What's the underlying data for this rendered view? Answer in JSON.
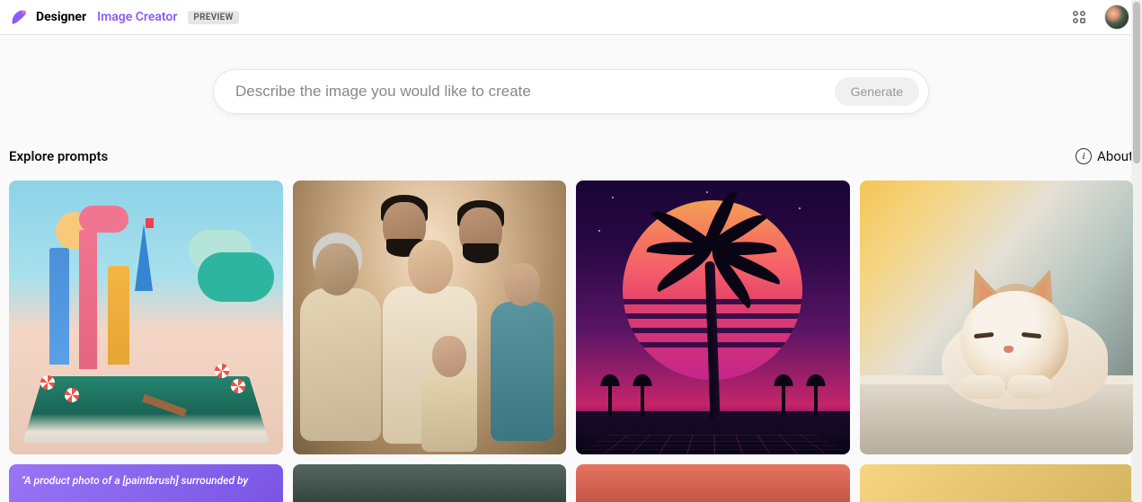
{
  "header": {
    "brand": "Designer",
    "product": "Image Creator",
    "badge": "PREVIEW"
  },
  "prompt": {
    "placeholder": "Describe the image you would like to create",
    "generate_label": "Generate"
  },
  "section": {
    "title": "Explore prompts",
    "about_label": "About"
  },
  "thumbnails": [
    {
      "name": "papercraft-city-popup"
    },
    {
      "name": "family-portrait-painting"
    },
    {
      "name": "retrowave-palm-sunset"
    },
    {
      "name": "sleeping-cat-windowsill"
    }
  ],
  "row2": {
    "card1_text": "\"A product photo of a [paintbrush] surrounded by"
  }
}
